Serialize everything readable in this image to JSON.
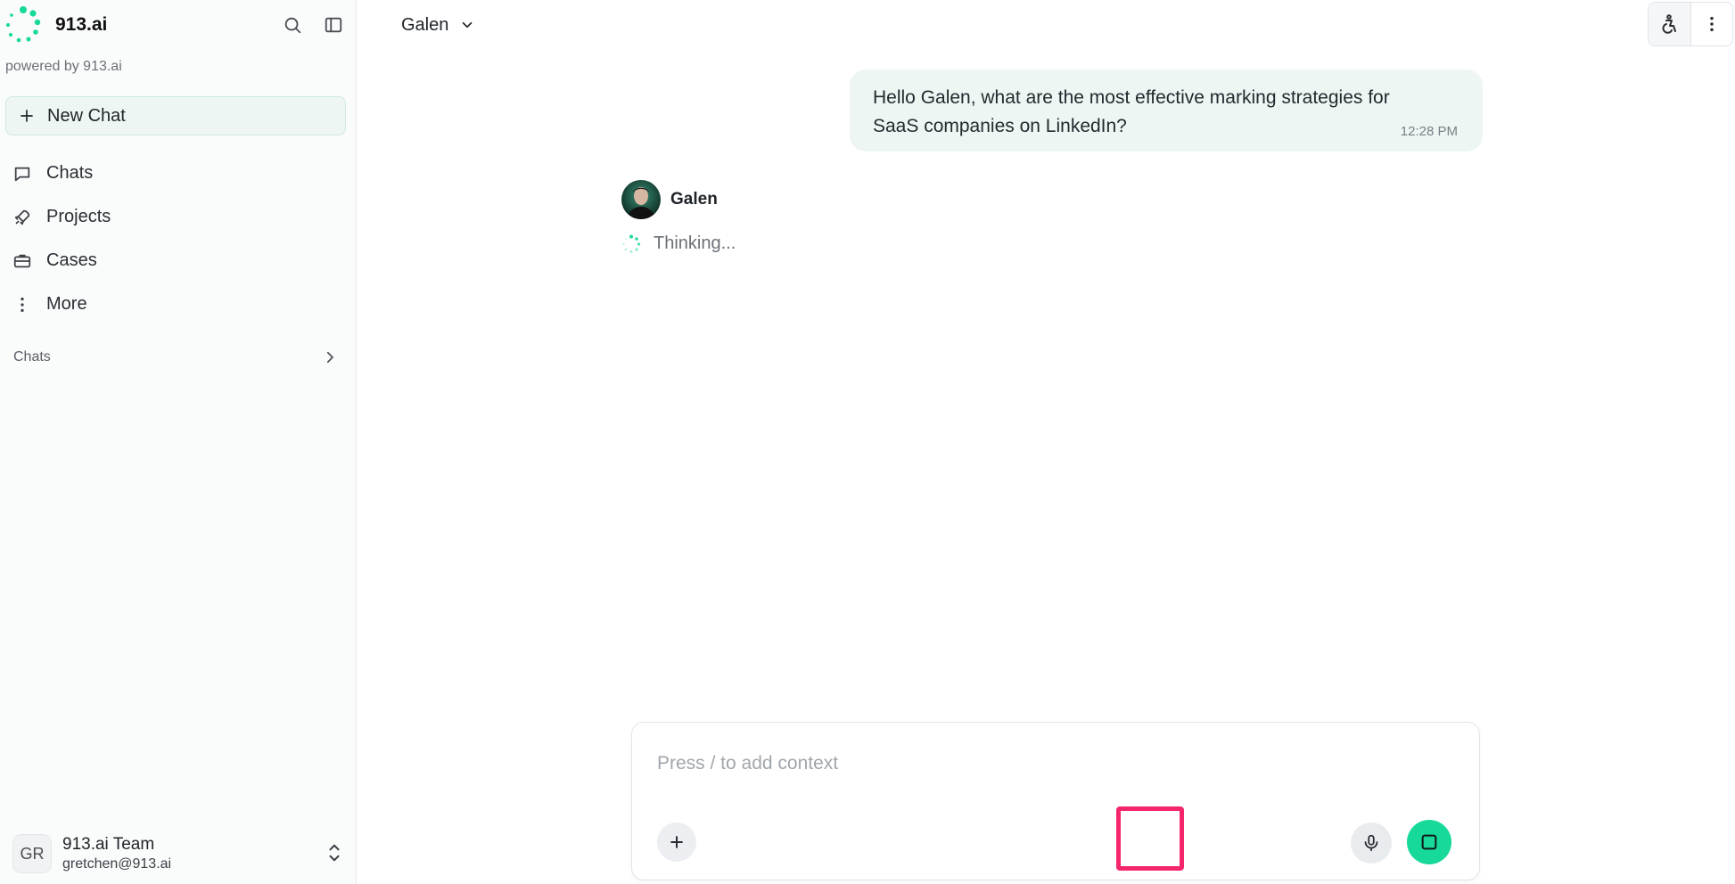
{
  "brand": {
    "name": "913.ai",
    "powered_by": "powered by 913.ai",
    "accent": "#17d99a"
  },
  "sidebar": {
    "search_icon": "search-icon",
    "toggle_icon": "sidebar-toggle-icon",
    "new_chat_label": "New Chat",
    "items": [
      {
        "label": "Chats",
        "icon": "chat-bubble-icon"
      },
      {
        "label": "Projects",
        "icon": "rocket-icon"
      },
      {
        "label": "Cases",
        "icon": "briefcase-icon"
      },
      {
        "label": "More",
        "icon": "more-vertical-icon"
      }
    ],
    "section_title": "Chats"
  },
  "user": {
    "initials": "GR",
    "name": "913.ai Team",
    "email": "gretchen@913.ai"
  },
  "header": {
    "agent_name": "Galen"
  },
  "conversation": {
    "user_message": "Hello Galen, what are the most effective marking strategies for SaaS companies on LinkedIn?",
    "user_message_time": "12:28 PM",
    "assistant_name": "Galen",
    "thinking_label": "Thinking..."
  },
  "composer": {
    "placeholder": "Press / to add context",
    "value": ""
  },
  "colors": {
    "highlight": "#f5256b",
    "bubble": "#eef6f4"
  }
}
